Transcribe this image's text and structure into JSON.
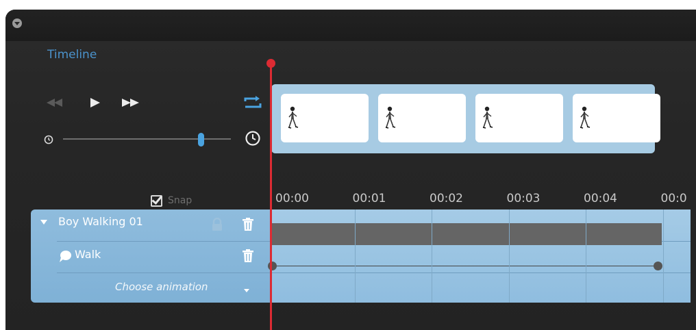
{
  "panel": {
    "title": "Timeline",
    "colors": {
      "accent": "#4b93cc",
      "playhead": "#dc2b33",
      "track": "#8fbcdd",
      "clip": "#656565"
    }
  },
  "transport": {
    "icons": [
      "rewind-icon",
      "play-icon",
      "fast-forward-icon",
      "loop-icon"
    ],
    "speed": {
      "min_icon": "clock-small-icon",
      "max_icon": "clock-large-icon",
      "value": 0.82
    }
  },
  "snap": {
    "label": "Snap",
    "checked": true
  },
  "preview": {
    "frame_count": 4,
    "frame_icon": "walking-boy-icon"
  },
  "ruler": {
    "ticks": [
      "00:00",
      "00:01",
      "00:02",
      "00:03",
      "00:04",
      "00:0"
    ]
  },
  "tracks": {
    "object": {
      "label": "Boy Walking 01",
      "icons": [
        "expand-triangle-icon",
        "lock-icon",
        "trash-icon"
      ]
    },
    "animation": {
      "label": "Walk",
      "icons": [
        "speech-bubble-icon",
        "trash-icon"
      ]
    },
    "chooser": {
      "label": "Choose animation"
    }
  },
  "playhead": {
    "time": "00:00"
  }
}
